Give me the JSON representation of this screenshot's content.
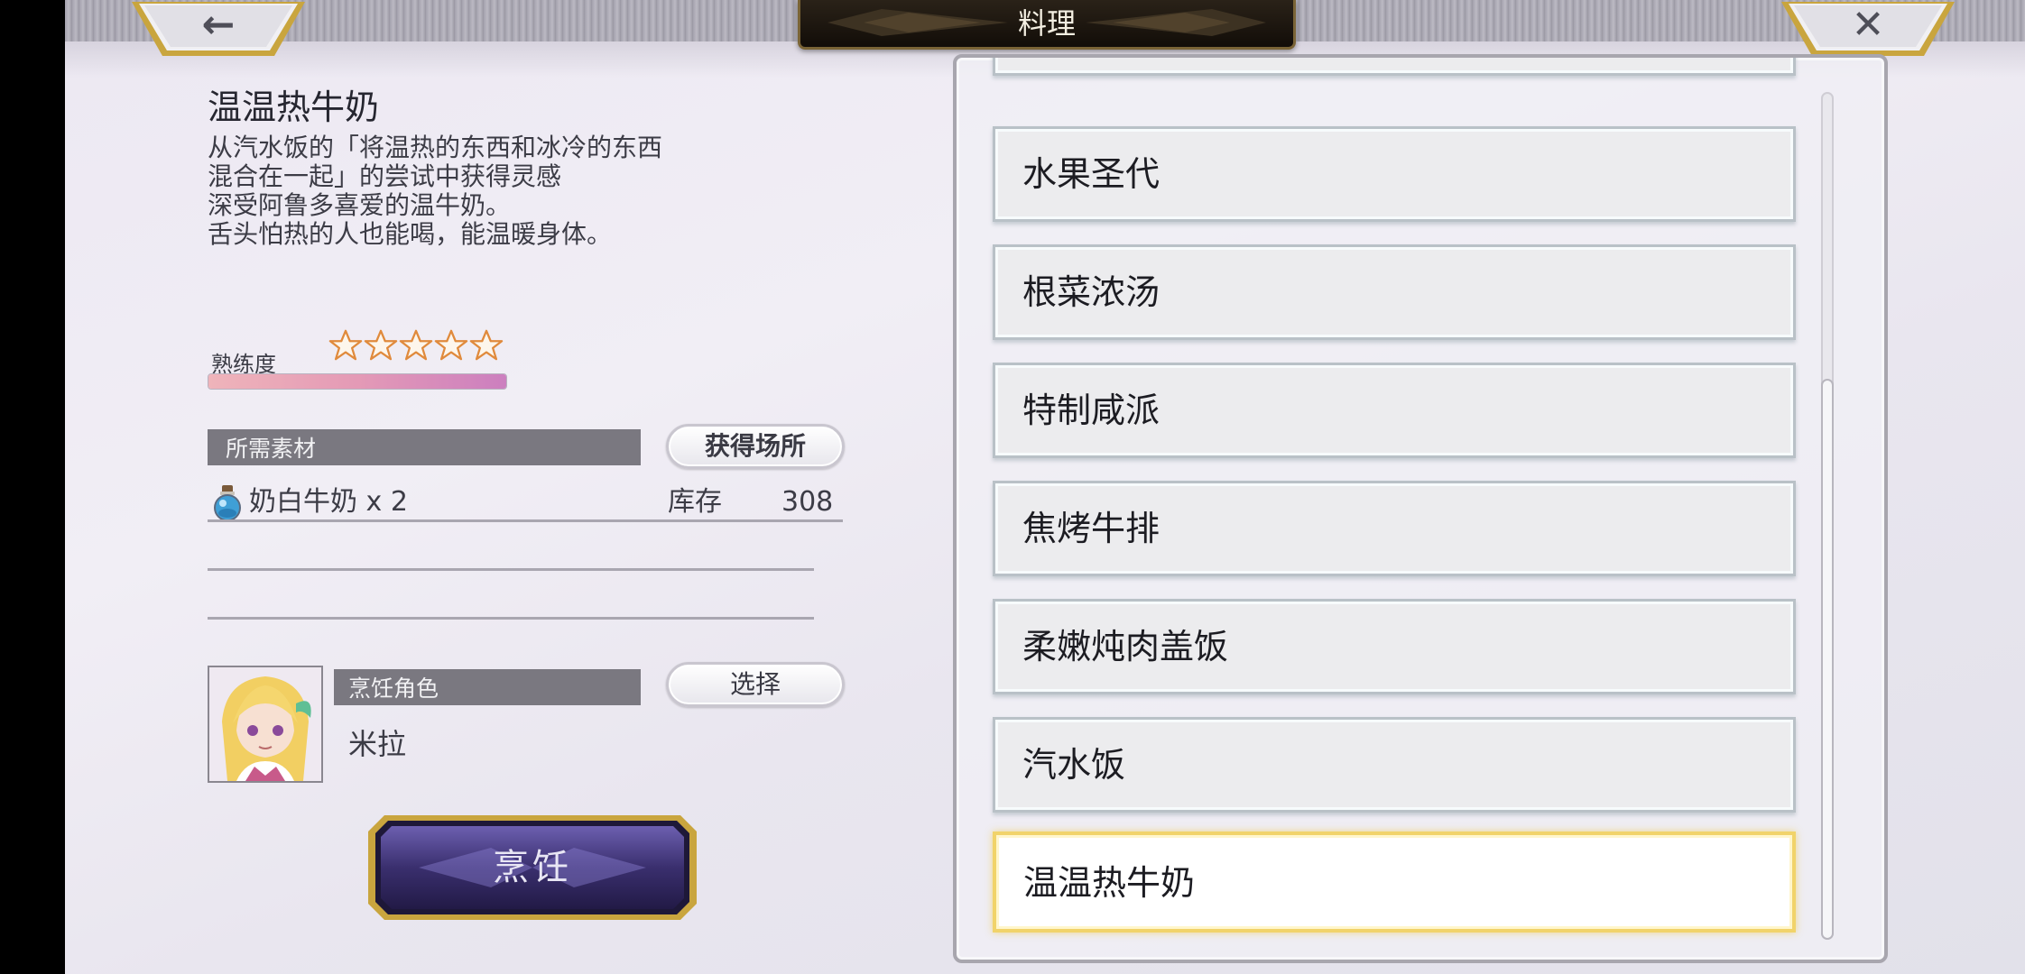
{
  "header": {
    "title": "料理",
    "back_icon": "arrow-left-icon",
    "close_icon": "close-icon",
    "back_glyph": "←",
    "close_glyph": "✕"
  },
  "detail": {
    "name": "温温热牛奶",
    "description": [
      "从汽水饭的「将温热的东西和冰冷的东西",
      "混合在一起」的尝试中获得灵感",
      "深受阿鲁多喜爱的温牛奶。",
      "舌头怕热的人也能喝，能温暖身体。"
    ],
    "mastery_label": "熟练度",
    "stars_total": 5,
    "stars_filled": 0,
    "mastery_progress": 1.0
  },
  "materials": {
    "section_label": "所需素材",
    "obtain_button": "获得场所",
    "items": [
      {
        "icon": "potion-bottle-icon",
        "name": "奶白牛奶 x 2",
        "stock_label": "库存",
        "stock": "308"
      }
    ]
  },
  "cook_role": {
    "section_label": "烹饪角色",
    "select_button": "选择",
    "character_name": "米拉"
  },
  "cook_button": "烹饪",
  "recipes": [
    {
      "label": "水果圣代",
      "selected": false
    },
    {
      "label": "根菜浓汤",
      "selected": false
    },
    {
      "label": "特制咸派",
      "selected": false
    },
    {
      "label": "焦烤牛排",
      "selected": false
    },
    {
      "label": "柔嫩炖肉盖饭",
      "selected": false
    },
    {
      "label": "汽水饭",
      "selected": false
    },
    {
      "label": "温温热牛奶",
      "selected": true
    }
  ],
  "colors": {
    "selected_border": "#f1d36a",
    "mastery_gradient_start": "#efb4ba",
    "mastery_gradient_end": "#cc7fbf",
    "cook_button": "#3a2f6e"
  }
}
